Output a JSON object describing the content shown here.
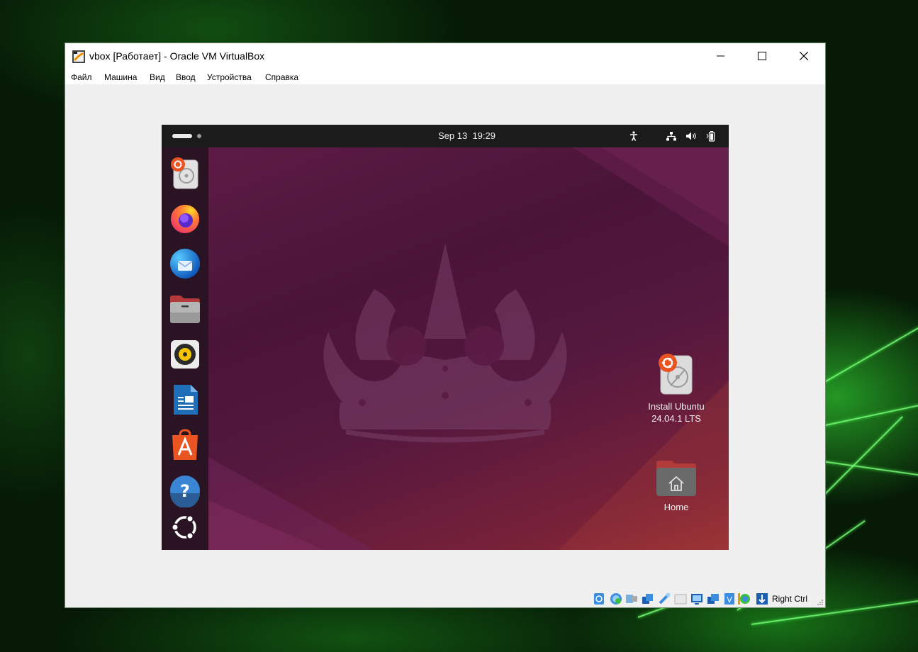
{
  "window": {
    "title": "vbox [Работает] - Oracle VM VirtualBox",
    "menu": [
      "Файл",
      "Машина",
      "Вид",
      "Ввод",
      "Устройства",
      "Справка"
    ]
  },
  "guest": {
    "topbar": {
      "date": "Sep 13",
      "time": "19:29"
    },
    "dock": [
      {
        "name": "install-ubuntu-icon"
      },
      {
        "name": "firefox-icon"
      },
      {
        "name": "thunderbird-icon"
      },
      {
        "name": "files-icon"
      },
      {
        "name": "rhythmbox-icon"
      },
      {
        "name": "libreoffice-writer-icon"
      },
      {
        "name": "app-center-icon"
      },
      {
        "name": "help-icon"
      },
      {
        "name": "show-apps-icon"
      }
    ],
    "desktop": {
      "install_label_1": "Install Ubuntu",
      "install_label_2": "24.04.1 LTS",
      "home_label": "Home"
    }
  },
  "statusbar": {
    "host_key": "Right Ctrl"
  },
  "colors": {
    "wallpaper": "#55183e",
    "ubuntu_orange": "#e95420",
    "dock_bg": "#2a1424"
  }
}
